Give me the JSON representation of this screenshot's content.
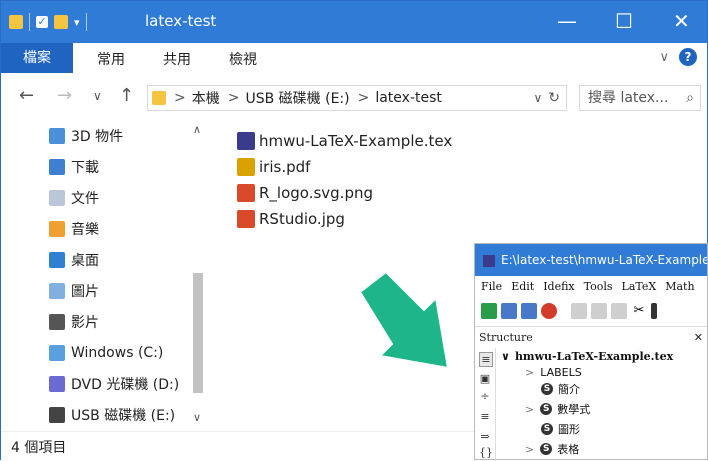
{
  "window": {
    "title": "latex-test",
    "minimize_glyph": "—",
    "maximize_glyph": "☐",
    "close_glyph": "✕"
  },
  "ribbon": {
    "tab_file": "檔案",
    "tabs": [
      "常用",
      "共用",
      "檢視"
    ],
    "expand_glyph": "∨",
    "help_glyph": "?"
  },
  "address": {
    "this_pc": "本機",
    "drive": "USB 磁碟機 (E:)",
    "folder": "latex-test",
    "search_placeholder": "搜尋 latex...",
    "separator": ">"
  },
  "nav": {
    "items": [
      {
        "label": "3D 物件",
        "color": "#4a90d9"
      },
      {
        "label": "下載",
        "color": "#3f7fd0"
      },
      {
        "label": "文件",
        "color": "#b9c7d8"
      },
      {
        "label": "音樂",
        "color": "#f0a030"
      },
      {
        "label": "桌面",
        "color": "#2f80d0"
      },
      {
        "label": "圖片",
        "color": "#7fb0e0"
      },
      {
        "label": "影片",
        "color": "#555555"
      },
      {
        "label": "Windows (C:)",
        "color": "#5aa0e0"
      },
      {
        "label": "DVD 光碟機 (D:)",
        "color": "#6a6ad0"
      },
      {
        "label": "USB 磁碟機 (E:)",
        "color": "#444444"
      }
    ]
  },
  "files": [
    {
      "name": "hmwu-LaTeX-Example.tex",
      "color": "#3b3b8c"
    },
    {
      "name": "iris.pdf",
      "color": "#d9a200"
    },
    {
      "name": "R_logo.svg.png",
      "color": "#d84a2a"
    },
    {
      "name": "RStudio.jpg",
      "color": "#d84a2a"
    }
  ],
  "status": {
    "count": "4 個項目"
  },
  "texstudio": {
    "title": "E:\\latex-test\\hmwu-LaTeX-Example.tex",
    "menu": [
      "File",
      "Edit",
      "Idefix",
      "Tools",
      "LaTeX",
      "Math"
    ],
    "structure_label": "Structure",
    "close_glyph": "✕",
    "root": "hmwu-LaTeX-Example.tex",
    "labels": "LABELS",
    "sections": [
      "簡介",
      "數學式",
      "圖形",
      "表格"
    ],
    "section_glyph": "S"
  },
  "colors": {
    "titlebar": "#2f7bd6",
    "accent": "#1f64c0",
    "arrow": "#1fb58a",
    "selection": "#cce4f7"
  }
}
